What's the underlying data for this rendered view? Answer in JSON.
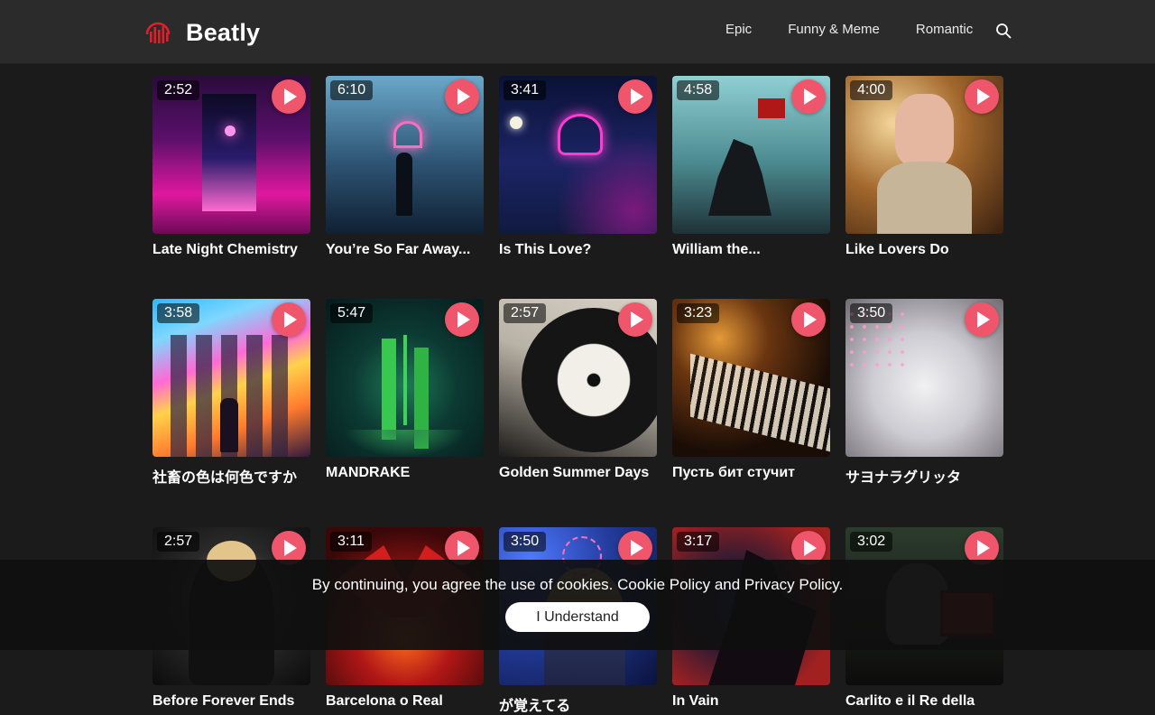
{
  "brand": {
    "name": "Beatly",
    "logo_icon": "sound-wave-logo-icon",
    "accent": "#e51d27"
  },
  "nav": {
    "links": [
      "Epic",
      "Funny & Meme",
      "Romantic"
    ],
    "search_icon": "search-icon"
  },
  "tracks": [
    {
      "title": "Late Night Chemistry",
      "duration": "2:52"
    },
    {
      "title": "You’re So Far Away...",
      "duration": "6:10"
    },
    {
      "title": "Is This Love?",
      "duration": "3:41"
    },
    {
      "title": "William the...",
      "duration": "4:58"
    },
    {
      "title": "Like Lovers Do",
      "duration": "4:00"
    },
    {
      "title": "社畜の色は何色ですか",
      "duration": "3:58"
    },
    {
      "title": "MANDRAKE",
      "duration": "5:47"
    },
    {
      "title": "Golden Summer Days",
      "duration": "2:57"
    },
    {
      "title": "Пусть бит стучит",
      "duration": "3:23"
    },
    {
      "title": "サヨナラグリッタ",
      "duration": "3:50"
    },
    {
      "title": "Before Forever Ends",
      "duration": "2:57"
    },
    {
      "title": "Barcelona o Real",
      "duration": "3:11"
    },
    {
      "title": "が覚えてる",
      "duration": "3:50"
    },
    {
      "title": "In Vain",
      "duration": "3:17"
    },
    {
      "title": "Carlito e il Re della",
      "duration": "3:02"
    }
  ],
  "play_button": {
    "icon": "play-icon",
    "color": "#f0566b"
  },
  "cookie": {
    "text": "By continuing, you agree the use of cookies. Cookie Policy and Privacy Policy.",
    "button_label": "I Understand"
  }
}
